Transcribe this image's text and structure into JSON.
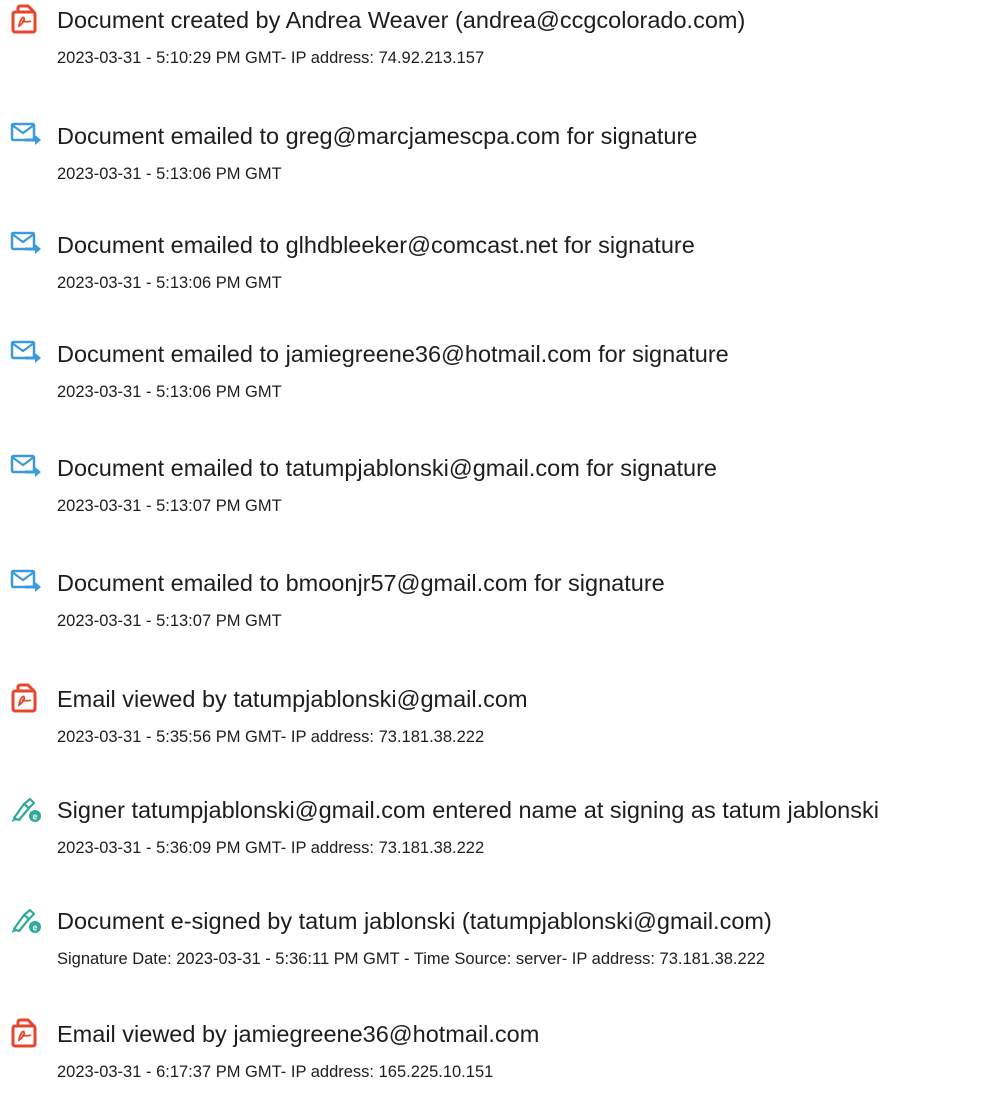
{
  "events": [
    {
      "icon": "document-created-icon",
      "title": "Document created by Andrea Weaver (andrea@ccgcolorado.com)",
      "detail": "2023-03-31 - 5:10:29 PM GMT- IP address: 74.92.213.157"
    },
    {
      "icon": "email-sent-icon",
      "title": "Document emailed to greg@marcjamescpa.com for signature",
      "detail": "2023-03-31 - 5:13:06 PM GMT"
    },
    {
      "icon": "email-sent-icon",
      "title": "Document emailed to glhdbleeker@comcast.net for signature",
      "detail": "2023-03-31 - 5:13:06 PM GMT"
    },
    {
      "icon": "email-sent-icon",
      "title": "Document emailed to jamiegreene36@hotmail.com for signature",
      "detail": "2023-03-31 - 5:13:06 PM GMT"
    },
    {
      "icon": "email-sent-icon",
      "title": "Document emailed to tatumpjablonski@gmail.com for signature",
      "detail": "2023-03-31 - 5:13:07 PM GMT"
    },
    {
      "icon": "email-sent-icon",
      "title": "Document emailed to bmoonjr57@gmail.com for signature",
      "detail": "2023-03-31 - 5:13:07 PM GMT"
    },
    {
      "icon": "document-viewed-icon",
      "title": "Email viewed by tatumpjablonski@gmail.com",
      "detail": "2023-03-31 - 5:35:56 PM GMT- IP address: 73.181.38.222"
    },
    {
      "icon": "signature-pen-icon",
      "title": "Signer tatumpjablonski@gmail.com entered name at signing as tatum jablonski",
      "detail": "2023-03-31 - 5:36:09 PM GMT- IP address: 73.181.38.222"
    },
    {
      "icon": "signature-pen-icon",
      "title": "Document e-signed by tatum jablonski (tatumpjablonski@gmail.com)",
      "detail": "Signature Date: 2023-03-31 - 5:36:11 PM GMT - Time Source: server- IP address: 73.181.38.222"
    },
    {
      "icon": "document-viewed-icon",
      "title": "Email viewed by jamiegreene36@hotmail.com",
      "detail": "2023-03-31 - 6:17:37 PM GMT- IP address: 165.225.10.151"
    }
  ],
  "colors": {
    "acrobat_red": "#e8452c",
    "email_blue": "#3b9ad9",
    "sign_green": "#2fa99a",
    "text": "#1d1d1d"
  }
}
